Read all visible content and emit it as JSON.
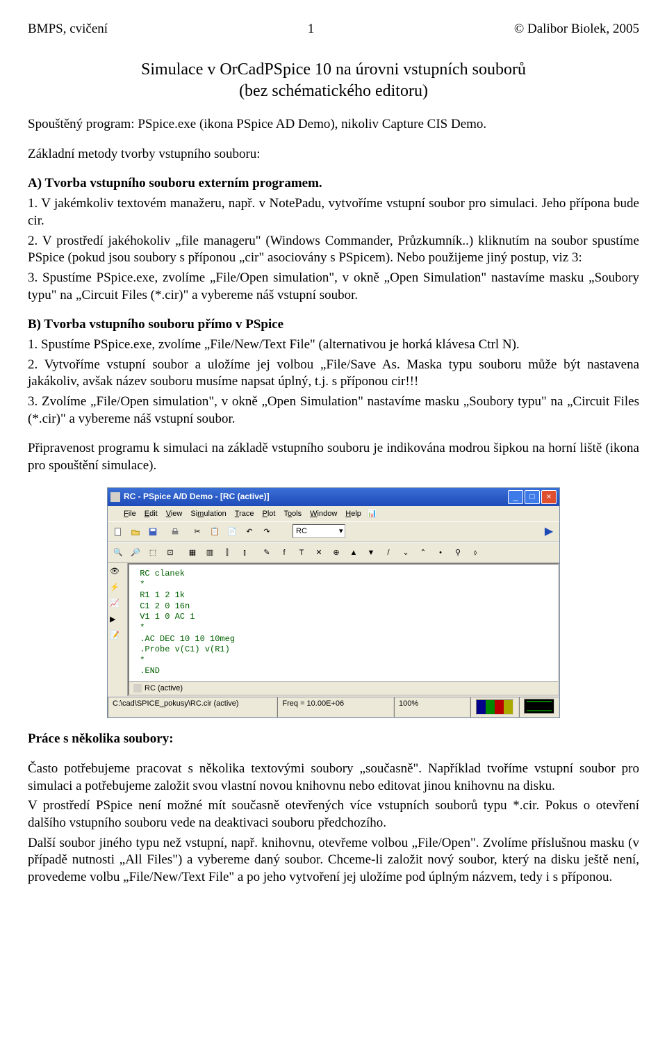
{
  "hdr": {
    "l": "BMPS, cvičení",
    "c": "1",
    "r": "© Dalibor Biolek, 2005"
  },
  "title1": "Simulace v OrCadPSpice 10 na úrovni vstupních souborů",
  "title2": "(bez schématického editoru)",
  "p1": "Spouštěný program: PSpice.exe (ikona PSpice AD Demo), nikoliv Capture CIS Demo.",
  "p2": "Základní metody tvorby vstupního souboru:",
  "a_h": "A) Tvorba vstupního souboru externím programem.",
  "a1": "1. V jakémkoliv textovém manažeru, např. v NotePadu, vytvoříme vstupní soubor pro simulaci. Jeho přípona bude cir.",
  "a2": "2. V prostředí jakéhokoliv „file manageru\" (Windows Commander, Průzkumník..) kliknutím na soubor spustíme PSpice (pokud jsou soubory s příponou „cir\" asociovány s PSpicem). Nebo použijeme jiný postup, viz 3:",
  "a3": "3. Spustíme PSpice.exe, zvolíme „File/Open simulation\", v okně „Open Simulation\" nastavíme masku „Soubory typu\" na „Circuit Files (*.cir)\" a vybereme náš vstupní soubor.",
  "b_h": "B) Tvorba vstupního souboru přímo v PSpice",
  "b1": "1. Spustíme PSpice.exe, zvolíme „File/New/Text File\" (alternativou je horká klávesa Ctrl N).",
  "b2": "2. Vytvoříme vstupní soubor a uložíme jej volbou „File/Save As. Maska typu souboru může být nastavena jakákoliv, avšak název souboru musíme napsat úplný, t.j. s příponou cir!!!",
  "b3": "3. Zvolíme „File/Open simulation\", v okně „Open Simulation\" nastavíme masku „Soubory typu\" na „Circuit Files (*.cir)\" a vybereme náš vstupní soubor.",
  "p3": "Připravenost programu k simulaci na základě vstupního souboru je indikována modrou šipkou na horní liště (ikona pro spouštění simulace).",
  "win": {
    "title": "RC - PSpice A/D Demo - [RC (active)]",
    "menu": [
      "File",
      "Edit",
      "View",
      "Simulation",
      "Trace",
      "Plot",
      "Tools",
      "Window",
      "Help"
    ],
    "combo": "RC",
    "code": " RC clanek\n *\n R1 1 2 1k\n C1 2 0 16n\n V1 1 0 AC 1\n *\n .AC DEC 10 10 10meg\n .Probe v(C1) v(R1)\n *\n .END",
    "tab": "RC (active)",
    "status": {
      "path": "C:\\cad\\SPICE_pokusy\\RC.cir (active)",
      "freq": "Freq = 10.00E+06",
      "pct": "100%"
    }
  },
  "h2": "Práce s několika soubory:",
  "p4": "Často potřebujeme pracovat s několika textovými soubory „současně\". Například tvoříme vstupní soubor pro simulaci a potřebujeme založit svou vlastní novou knihovnu nebo editovat jinou knihovnu na disku.",
  "p5": "V prostředí PSpice není možné mít současně otevřených více vstupních souborů typu *.cir. Pokus o otevření dalšího vstupního souboru vede na deaktivaci souboru předchozího.",
  "p6": "Další soubor jiného typu než vstupní, např. knihovnu, otevřeme volbou „File/Open\". Zvolíme příslušnou masku (v případě nutnosti „All Files\") a vybereme daný soubor. Chceme-li založit nový soubor, který na disku ještě není, provedeme volbu „File/New/Text File\" a po jeho vytvoření jej uložíme pod úplným názvem, tedy i s příponou."
}
